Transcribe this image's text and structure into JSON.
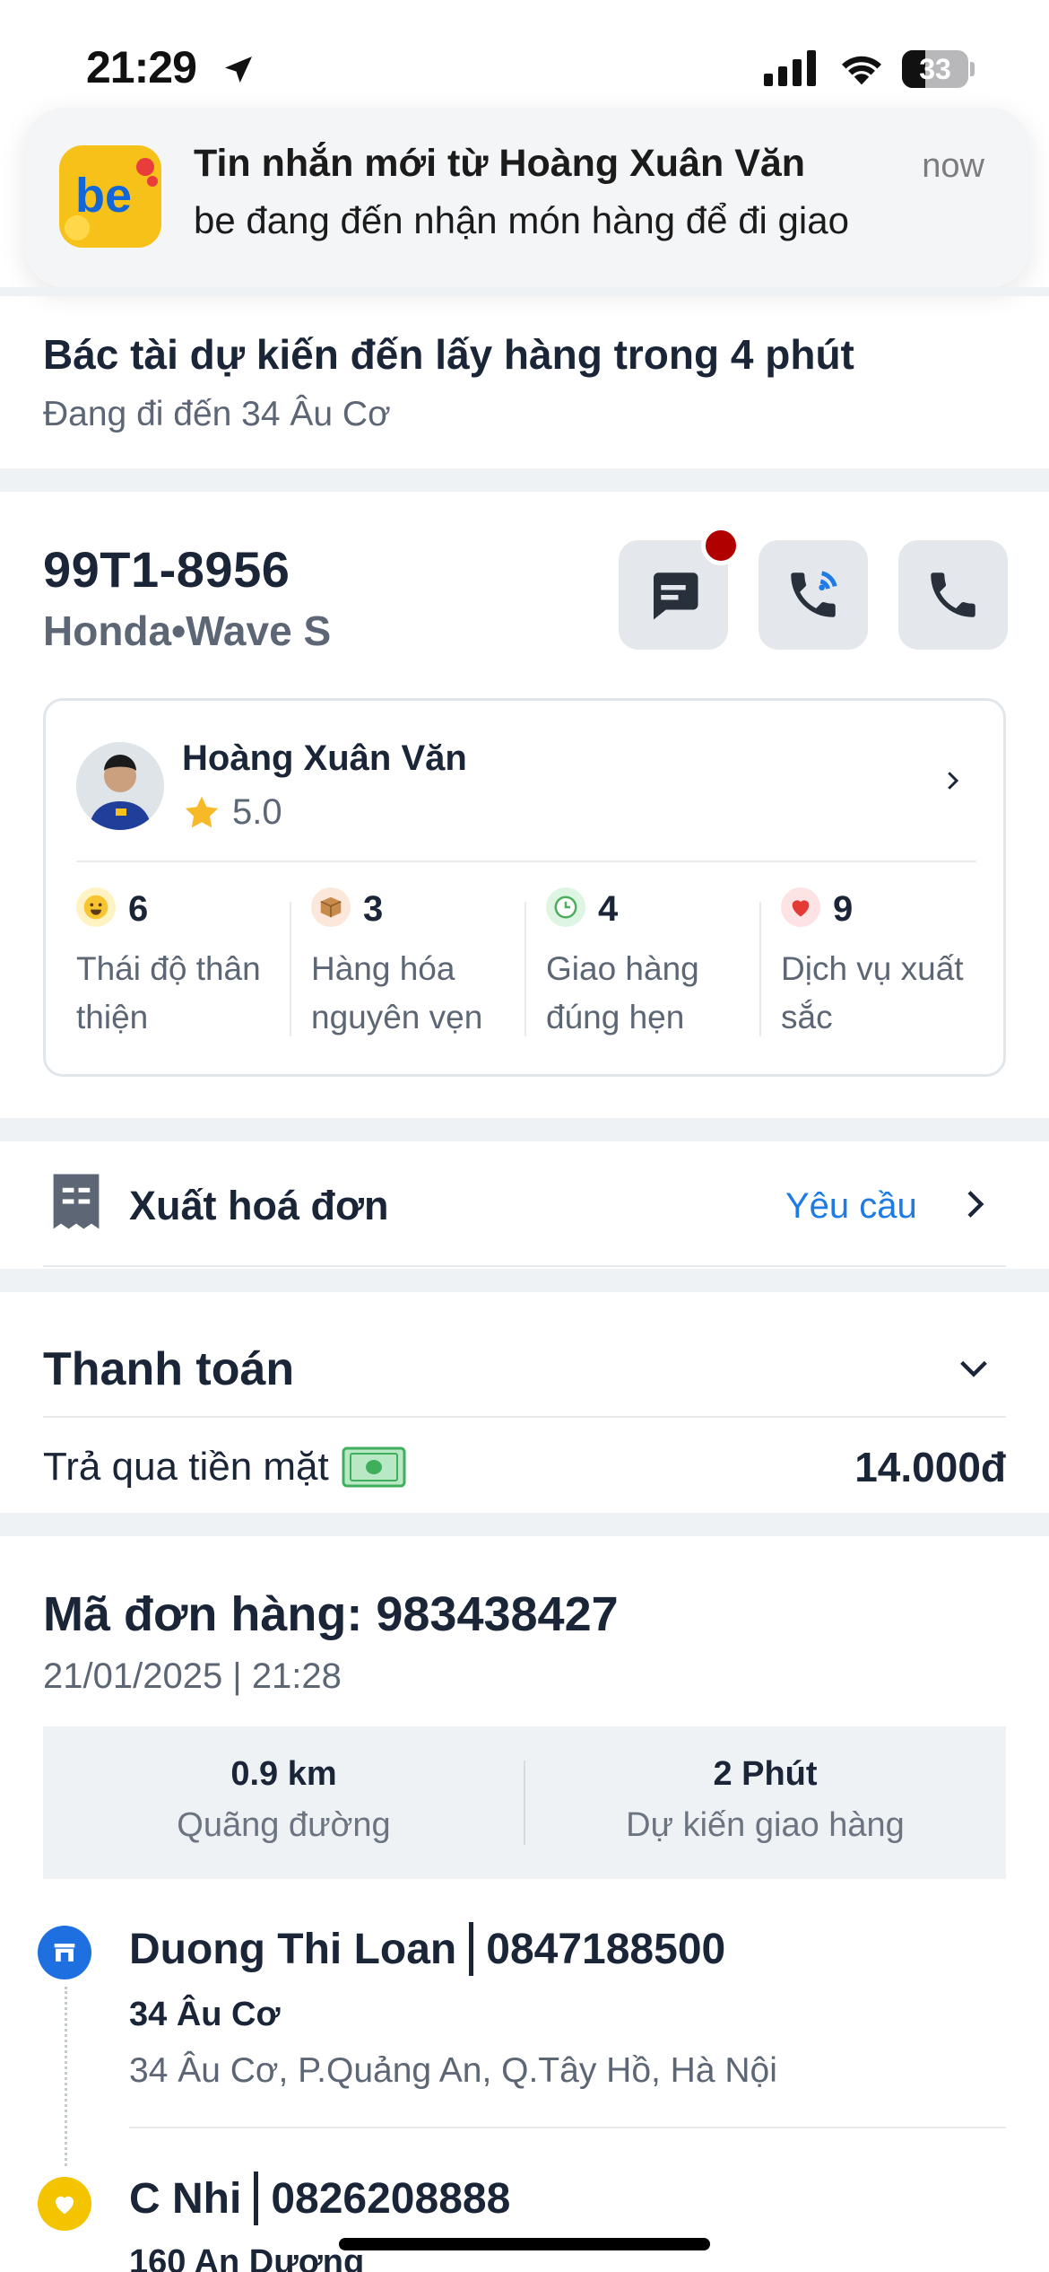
{
  "status_bar": {
    "time": "21:29",
    "battery": "33"
  },
  "notification": {
    "app_icon": "be-app-logo",
    "title": "Tin nhắn mới từ Hoàng Xuân Văn",
    "body": "be đang đến nhận món hàng để đi giao",
    "time": "now"
  },
  "eta": {
    "title": "Bác tài dự kiến đến lấy hàng trong 4 phút",
    "subtitle": "Đang đi đến 34 Âu Cơ"
  },
  "vehicle": {
    "plate": "99T1-8956",
    "model": "Honda•Wave S"
  },
  "actions": {
    "chat_icon": "chat-icon",
    "voip_icon": "wifi-call-icon",
    "phone_icon": "phone-icon"
  },
  "driver": {
    "name": "Hoàng Xuân Văn",
    "rating": "5.0",
    "stats": [
      {
        "icon": "smile-emoji-icon",
        "count": "6",
        "label": "Thái độ thân thiện"
      },
      {
        "icon": "package-icon",
        "count": "3",
        "label": "Hàng hóa nguyên vẹn"
      },
      {
        "icon": "clock-icon",
        "count": "4",
        "label": "Giao hàng đúng hẹn"
      },
      {
        "icon": "heart-icon",
        "count": "9",
        "label": "Dịch vụ xuất sắc"
      }
    ]
  },
  "invoice": {
    "label": "Xuất hoá đơn",
    "action": "Yêu cầu"
  },
  "payment": {
    "title": "Thanh toán",
    "method": "Trả qua tiền mặt",
    "amount": "14.000đ"
  },
  "order": {
    "code_label": "Mã đơn hàng: 983438427",
    "datetime": "21/01/2025 | 21:28",
    "distance_value": "0.9 km",
    "distance_label": "Quãng đường",
    "duration_value": "2 Phút",
    "duration_label": "Dự kiến giao hàng",
    "stops": [
      {
        "contact": "Duong Thi Loan",
        "phone": "0847188500",
        "name": "34 Âu Cơ",
        "address": "34 Âu Cơ, P.Quảng An, Q.Tây Hồ, Hà Nội"
      },
      {
        "contact": "C Nhi",
        "phone": "0826208888",
        "name": "160 An Dương",
        "address": ""
      }
    ]
  },
  "colors": {
    "accent": "#1e7be6",
    "text": "#1a2538",
    "muted": "#5c6675",
    "badge": "#b00000",
    "pickup": "#1e6fe0",
    "dropoff": "#f5c400"
  }
}
